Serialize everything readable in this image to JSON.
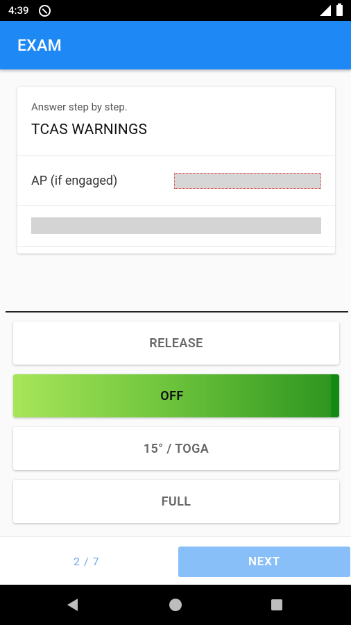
{
  "status_bar": {
    "time": "4:39"
  },
  "app_bar": {
    "title": "EXAM"
  },
  "question": {
    "instruction": "Answer step by step.",
    "title": "TCAS WARNINGS",
    "steps": [
      {
        "label": "AP (if engaged)",
        "answer": ""
      },
      {
        "label": "",
        "answer": ""
      }
    ]
  },
  "options": [
    {
      "label": "RELEASE",
      "selected": false
    },
    {
      "label": "OFF",
      "selected": true
    },
    {
      "label": "15° / TOGA",
      "selected": false
    },
    {
      "label": "FULL",
      "selected": false
    }
  ],
  "footer": {
    "progress": "2 / 7",
    "next_label": "NEXT"
  },
  "colors": {
    "app_bar": "#1e88f5",
    "next_button": "#88bff8",
    "selected_option_start": "#a8e55a",
    "selected_option_end": "#138a12"
  }
}
